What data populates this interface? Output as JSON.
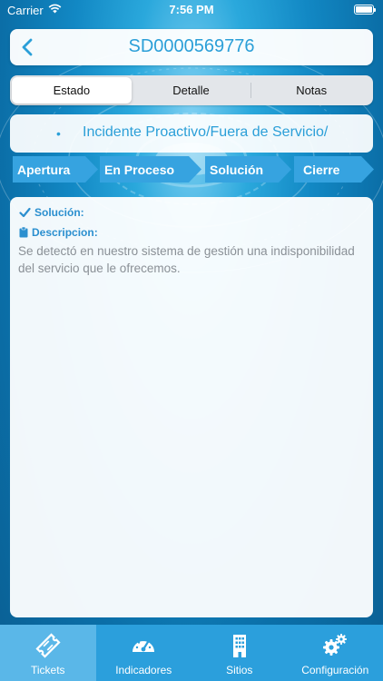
{
  "status_bar": {
    "carrier": "Carrier",
    "time": "7:56 PM"
  },
  "header": {
    "title": "SD0000569776"
  },
  "tabs": [
    {
      "label": "Estado",
      "active": true
    },
    {
      "label": "Detalle",
      "active": false
    },
    {
      "label": "Notas",
      "active": false
    }
  ],
  "incident": {
    "category": "Incidente Proactivo/Fuera de Servicio/"
  },
  "stages": [
    "Apertura",
    "En Proceso",
    "Solución",
    "Cierre"
  ],
  "detail": {
    "solution_label": "Solución:",
    "description_label": "Descripcion:",
    "description_text": "Se detectó en nuestro sistema de gestión una indisponibilidad del servicio que le ofrecemos."
  },
  "tabbar": [
    {
      "label": "Tickets",
      "icon": "ticket-icon",
      "active": true
    },
    {
      "label": "Indicadores",
      "icon": "speedometer-icon",
      "active": false
    },
    {
      "label": "Sitios",
      "icon": "building-icon",
      "active": false
    },
    {
      "label": "Configuración",
      "icon": "gears-icon",
      "active": false
    }
  ],
  "colors": {
    "accent": "#2b9fd8",
    "tabbar": "#2b9fdc",
    "tabbar_active": "#5ab7e8",
    "stage_arrow": "#36a3e0"
  }
}
